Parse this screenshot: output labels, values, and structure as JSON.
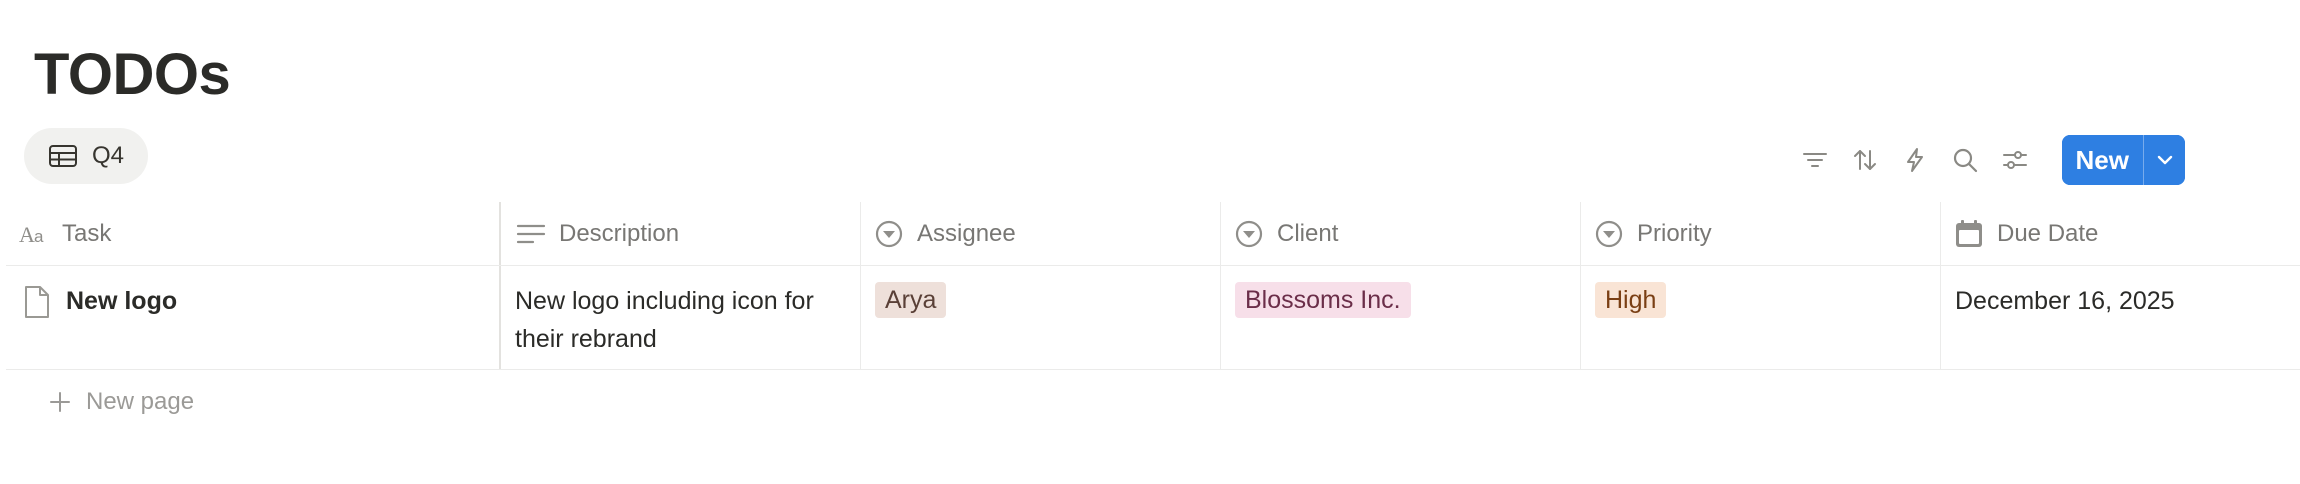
{
  "page": {
    "title": "TODOs"
  },
  "view": {
    "tab_label": "Q4",
    "tab_icon": "table-icon"
  },
  "toolbar": {
    "icons": [
      "filter-icon",
      "sort-icon",
      "automation-icon",
      "search-icon",
      "settings-icon"
    ],
    "new_label": "New"
  },
  "table": {
    "columns": [
      {
        "label": "Task",
        "icon": "text-type-icon"
      },
      {
        "label": "Description",
        "icon": "lines-icon"
      },
      {
        "label": "Assignee",
        "icon": "select-icon"
      },
      {
        "label": "Client",
        "icon": "select-icon"
      },
      {
        "label": "Priority",
        "icon": "select-icon"
      },
      {
        "label": "Due Date",
        "icon": "calendar-icon"
      }
    ],
    "rows": [
      {
        "task": "New logo",
        "description": "New logo including icon for their rebrand",
        "assignee": "Arya",
        "client": "Blossoms Inc.",
        "priority": "High",
        "due_date": "December 16, 2025"
      }
    ]
  },
  "footer": {
    "new_page_label": "New page"
  },
  "colors": {
    "accent": "#2e7fe2",
    "tag_assignee_bg": "#eee0da",
    "tag_client_bg": "#f7dfe9",
    "tag_priority_bg": "#f9e4d5"
  }
}
